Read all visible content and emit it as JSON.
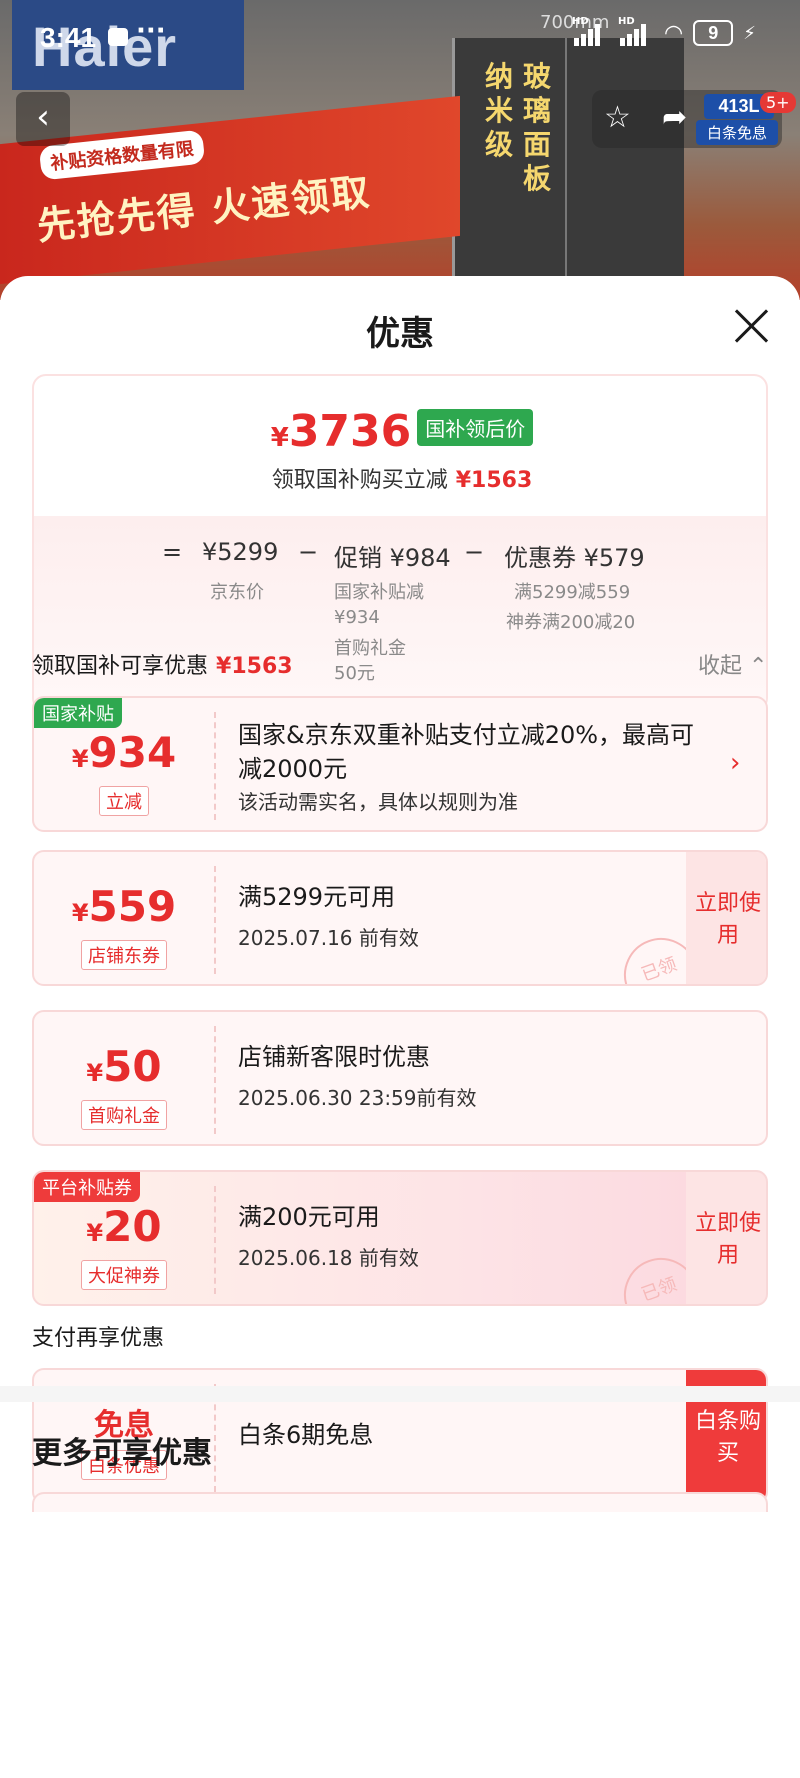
{
  "status_bar": {
    "time": "3:41",
    "dots": "···",
    "network1": "HD",
    "network2": "HD",
    "battery": "9"
  },
  "product_bg": {
    "brand": "Haier",
    "dimension": "700mm",
    "panel_left": "纳米级",
    "panel_right": "玻璃面板",
    "banner_sub": "补贴资格数量有限",
    "banner_main": "先抢先得 火速领取",
    "capacity": "413L",
    "free_interest": "白条免息",
    "badge_count": "5+"
  },
  "sheet": {
    "title": "优惠"
  },
  "summary": {
    "yuan_symbol": "¥",
    "final_price": "3736",
    "final_tag": "国补领后价",
    "sub_text": "领取国补购买立减",
    "sub_amount": "¥1563",
    "eq": "=",
    "jd_price": "¥5299",
    "jd_price_label": "京东价",
    "minus1": "−",
    "promo": "促销 ¥984",
    "promo_note1": "国家补贴减",
    "promo_note2": "¥934",
    "promo_note3": "首购礼金",
    "promo_note4": "50元",
    "minus2": "−",
    "coupon": "优惠券 ¥579",
    "coupon_note1": "满5299减559",
    "coupon_note2": "神券满200减20"
  },
  "section1": {
    "label": "领取国补可享优惠",
    "amount": "¥1563",
    "collapse": "收起"
  },
  "coupons": [
    {
      "corner": "国家补贴",
      "symbol": "¥",
      "value": "934",
      "type": "立减",
      "desc": "国家&京东双重补贴支付立减20%，最高可减2000元",
      "desc2": "该活动需实名，具体以规则为准"
    },
    {
      "symbol": "¥",
      "value": "559",
      "type": "店铺东券",
      "desc": "满5299元可用",
      "desc2": "2025.07.16 前有效",
      "action": "立即使用",
      "stamp": "已领"
    },
    {
      "symbol": "¥",
      "value": "50",
      "type": "首购礼金",
      "desc": "店铺新客限时优惠",
      "desc2": "2025.06.30 23:59前有效"
    },
    {
      "corner": "平台补贴券",
      "symbol": "¥",
      "value": "20",
      "type": "大促神券",
      "desc": "满200元可用",
      "desc2": "2025.06.18 前有效",
      "action": "立即使用",
      "stamp": "已领"
    }
  ],
  "section2": {
    "label": "支付再享优惠"
  },
  "pay_card": {
    "title": "免息",
    "type": "白条优惠",
    "desc": "白条6期免息",
    "action": "白条购买"
  },
  "more": {
    "title": "更多可享优惠"
  },
  "colors": {
    "accent_red": "#e62d2d",
    "tag_green": "#2ea84f"
  }
}
